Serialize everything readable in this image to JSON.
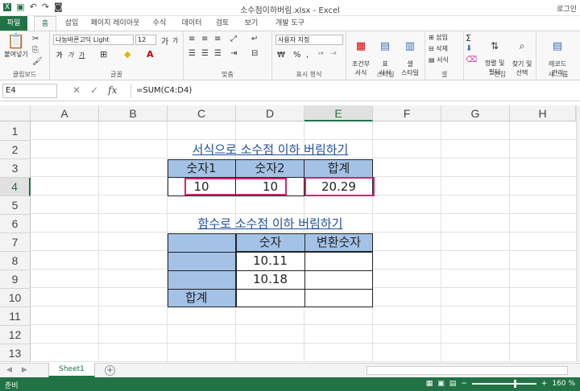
{
  "window": {
    "title": "소수점이하버림.xlsx - Excel",
    "login": "로그인",
    "qat": {
      "save_icon": "save-icon",
      "undo_icon": "undo-icon",
      "redo_icon": "redo-icon",
      "camera_icon": "camera-icon"
    }
  },
  "ribbon_tabs": [
    "파일",
    "홈",
    "삽입",
    "페이지 레이아웃",
    "수식",
    "데이터",
    "검토",
    "보기",
    "개발 도구"
  ],
  "ribbon": {
    "clipboard": {
      "paste": "붙여넣기",
      "label": "클립보드"
    },
    "font": {
      "name": "나눔바른고딕 Light",
      "size": "12",
      "label": "글꼴",
      "ga": "가",
      "ga2": "가",
      "bold": "가",
      "italic": "가",
      "underline": "가"
    },
    "alignment": {
      "label": "맞춤"
    },
    "number": {
      "format": "사용자 지정",
      "label": "표시 형식",
      "percent": "%",
      "comma": ","
    },
    "styles": {
      "cond": "조건부\n서식",
      "table": "표\n서식",
      "cell": "셀\n스타일",
      "label": "스타일"
    },
    "cells": {
      "insert": "삽입",
      "delete": "삭제",
      "format": "서식",
      "label": "셀"
    },
    "editing": {
      "sort": "정렬 및\n필터",
      "find": "찾기 및\n선택",
      "label": "편집"
    },
    "newgroup": {
      "record": "레코드\n관리",
      "label": "새 그룹"
    }
  },
  "formula_bar": {
    "name_box": "E4",
    "fx": "fx",
    "cancel": "✕",
    "enter": "✓",
    "formula": "=SUM(C4:D4)"
  },
  "columns": [
    "A",
    "B",
    "C",
    "D",
    "E",
    "F",
    "G",
    "H"
  ],
  "rows": [
    "1",
    "2",
    "3",
    "4",
    "5",
    "6",
    "7",
    "8",
    "9",
    "10",
    "11",
    "12",
    "13"
  ],
  "sheet": {
    "title1": "서식으로 소수점 이하 버림하기",
    "title2": "함수로 소수점 이하 버림하기",
    "t1_headers": [
      "숫자1",
      "숫자2",
      "합계"
    ],
    "t1_values": [
      "10",
      "10",
      "20.29"
    ],
    "t2_headers": [
      "숫자",
      "변환숫자"
    ],
    "t2_values": [
      "10.11",
      "10.18"
    ],
    "t2_total": "합계"
  },
  "sheet_tabs": {
    "active": "Sheet1",
    "add": "+"
  },
  "status": {
    "ready": "준비",
    "zoom": "160 %"
  },
  "colors": {
    "accent": "#217346",
    "header_fill": "#a4c2e6",
    "link_blue": "#1f4e9c",
    "highlight": "#d6246e"
  }
}
